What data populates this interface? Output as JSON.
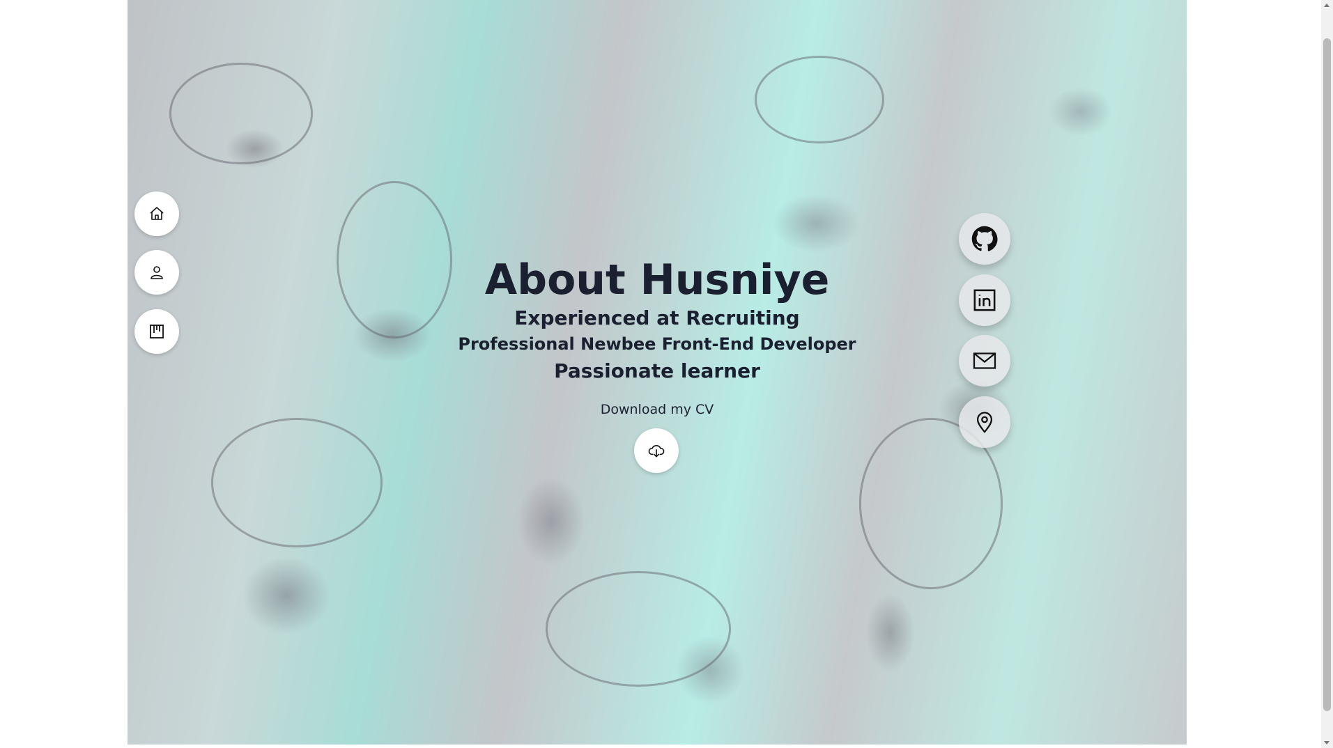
{
  "hero": {
    "title": "About Husniye",
    "line1": "Experienced at Recruiting",
    "line2": "Professional Newbee Front-End Developer",
    "line3": "Passionate learner"
  },
  "cv": {
    "label": "Download my CV",
    "icon": "cloud-download-icon"
  },
  "nav": [
    {
      "name": "home",
      "icon": "home-icon"
    },
    {
      "name": "about",
      "icon": "person-icon"
    },
    {
      "name": "projects",
      "icon": "board-icon"
    }
  ],
  "social": [
    {
      "name": "github",
      "icon": "github-icon"
    },
    {
      "name": "linkedin",
      "icon": "linkedin-icon"
    },
    {
      "name": "email",
      "icon": "mail-icon"
    },
    {
      "name": "location",
      "icon": "map-pin-icon"
    }
  ],
  "colors": {
    "text": "#1b2030",
    "button_bg": "#ffffff",
    "marble_teal": "#a8dcd6",
    "marble_gray": "#c3c6ca"
  }
}
